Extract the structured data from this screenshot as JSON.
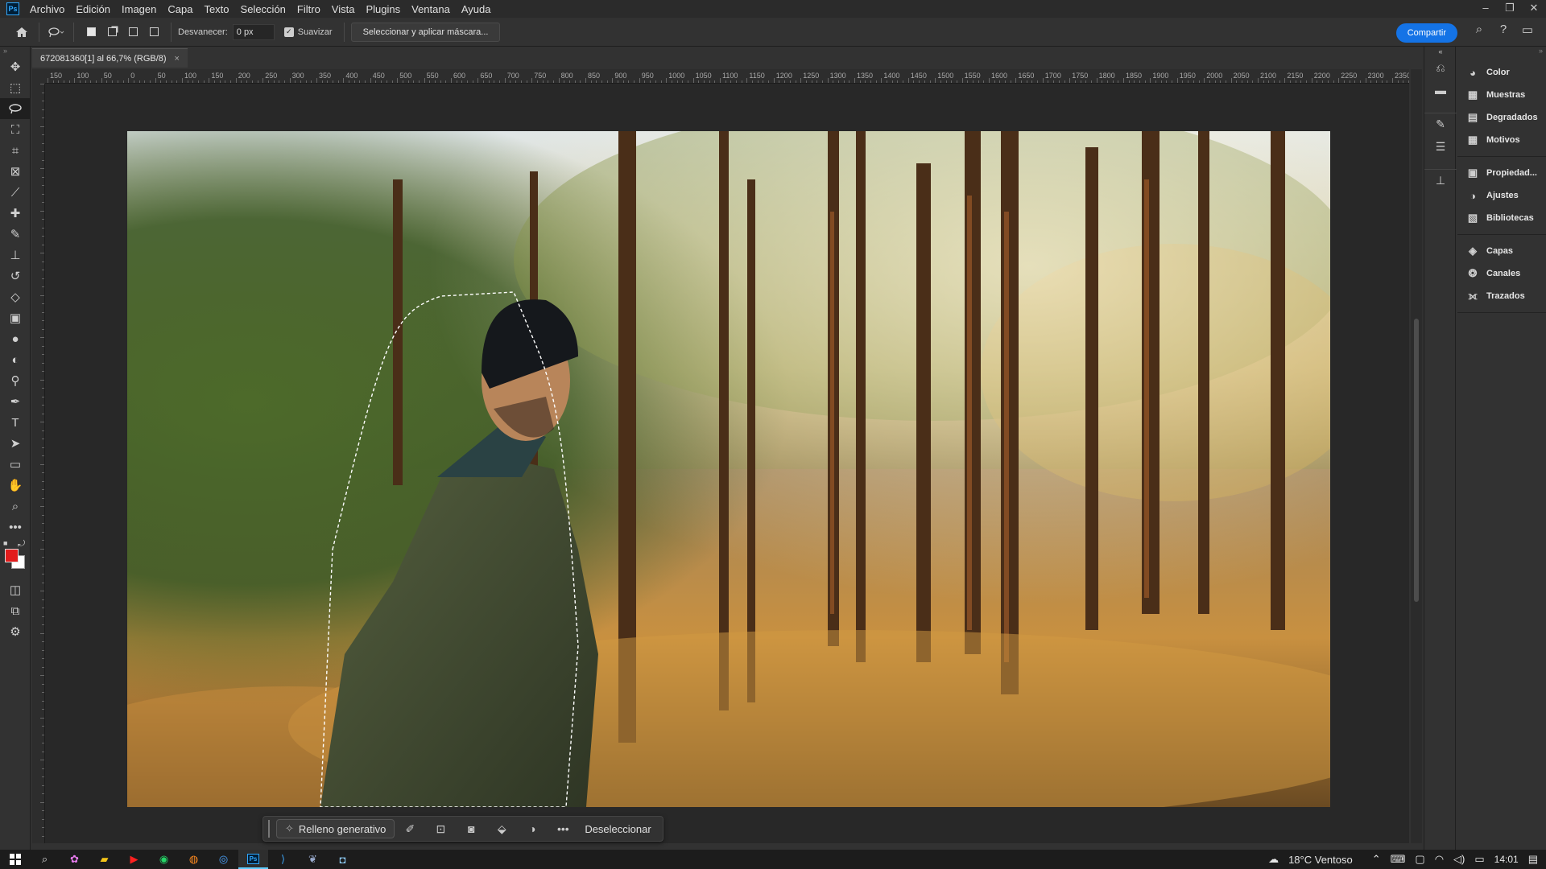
{
  "menubar": {
    "logo": "Ps",
    "items": [
      "Archivo",
      "Edición",
      "Imagen",
      "Capa",
      "Texto",
      "Selección",
      "Filtro",
      "Vista",
      "Plugins",
      "Ventana",
      "Ayuda"
    ],
    "window_controls": [
      "–",
      "❐",
      "✕"
    ]
  },
  "options": {
    "feather_label": "Desvanecer:",
    "feather_value": "0 px",
    "antialias_label": "Suavizar",
    "antialias_checked": true,
    "select_mask_label": "Seleccionar y aplicar máscara...",
    "share_label": "Compartir"
  },
  "document": {
    "tab_title": "672081360[1] al 66,7% (RGB/8)",
    "close": "×"
  },
  "ruler": {
    "labels": [
      "150",
      "100",
      "50",
      "0",
      "50",
      "100",
      "150",
      "200",
      "250",
      "300",
      "350",
      "400",
      "450",
      "500",
      "550",
      "600",
      "650",
      "700",
      "750",
      "800",
      "850",
      "900",
      "950",
      "1000",
      "1050",
      "1100",
      "1150",
      "1200",
      "1250",
      "1300",
      "1350",
      "1400",
      "1450",
      "1500",
      "1550",
      "1600",
      "1650",
      "1700",
      "1750",
      "1800",
      "1850",
      "1900",
      "1950",
      "2000",
      "2050",
      "2100",
      "2150",
      "2200",
      "2250",
      "2300",
      "2350"
    ]
  },
  "contextual_taskbar": {
    "generative_fill": "Relleno generativo",
    "deselect": "Deseleccionar"
  },
  "panels": {
    "group1": [
      {
        "icon": "color-icon",
        "label": "Color"
      },
      {
        "icon": "swatches-icon",
        "label": "Muestras"
      },
      {
        "icon": "gradients-icon",
        "label": "Degradados"
      },
      {
        "icon": "patterns-icon",
        "label": "Motivos"
      }
    ],
    "group2": [
      {
        "icon": "properties-icon",
        "label": "Propiedad..."
      },
      {
        "icon": "adjustments-icon",
        "label": "Ajustes"
      },
      {
        "icon": "libraries-icon",
        "label": "Bibliotecas"
      }
    ],
    "group3": [
      {
        "icon": "layers-icon",
        "label": "Capas"
      },
      {
        "icon": "channels-icon",
        "label": "Canales"
      },
      {
        "icon": "paths-icon",
        "label": "Trazados"
      }
    ]
  },
  "colors": {
    "foreground": "#e21c1c",
    "background": "#ffffff",
    "accent": "#1473e6"
  },
  "taskbar": {
    "weather": "18°C  Ventoso",
    "time": "14:01"
  }
}
